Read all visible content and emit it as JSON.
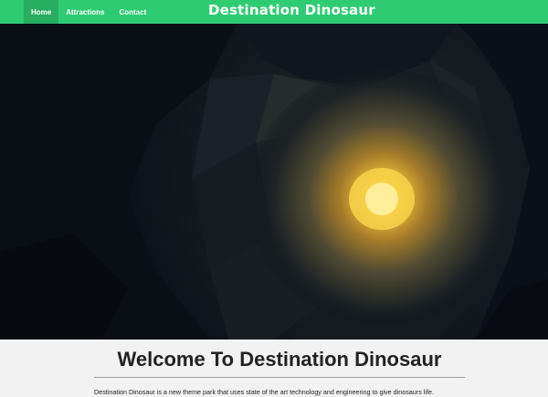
{
  "nav": {
    "links": [
      {
        "label": "Home",
        "active": true
      },
      {
        "label": "Attractions",
        "active": false
      },
      {
        "label": "Contact",
        "active": false
      }
    ],
    "brand": "Destination Dinosaur"
  },
  "hero": {
    "image": "dark-cave-with-glowing-light-painting"
  },
  "content": {
    "title": "Welcome To Destination Dinosaur",
    "intro": "Destination Dinosaur is a new theme park that uses state of the art technology and engineering to give dinosaurs life."
  },
  "colors": {
    "nav_bg": "#2ecc71",
    "nav_active_bg": "#27ae60",
    "page_bg": "#f2f2f2",
    "cave_dark": "#0c1119",
    "cave_glow": "#f4c238"
  }
}
